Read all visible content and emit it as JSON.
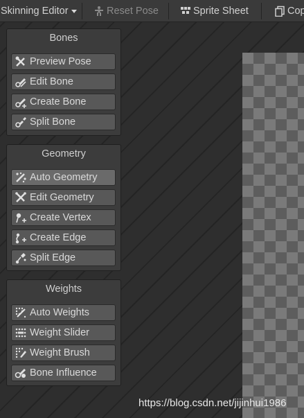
{
  "toolbar": {
    "editor_mode": "Skinning Editor",
    "reset_pose": "Reset Pose",
    "sprite_sheet": "Sprite Sheet",
    "copy": "Cop"
  },
  "panels": {
    "bones": {
      "title": "Bones",
      "items": [
        "Preview Pose",
        "Edit Bone",
        "Create Bone",
        "Split Bone"
      ]
    },
    "geometry": {
      "title": "Geometry",
      "items": [
        "Auto Geometry",
        "Edit Geometry",
        "Create Vertex",
        "Create Edge",
        "Split Edge"
      ],
      "active": "Auto Geometry"
    },
    "weights": {
      "title": "Weights",
      "items": [
        "Auto Weights",
        "Weight Slider",
        "Weight Brush",
        "Bone Influence"
      ]
    }
  },
  "watermark": "https://blog.csdn.net/jijinhui1986",
  "colors": {
    "toolbar_bg": "#3a3a3a",
    "panel_bg": "#3c3c3c",
    "button_bg": "#585858",
    "button_active_bg": "#6a6a6a",
    "text": "#dadada",
    "disabled_text": "#8a8a8a"
  }
}
